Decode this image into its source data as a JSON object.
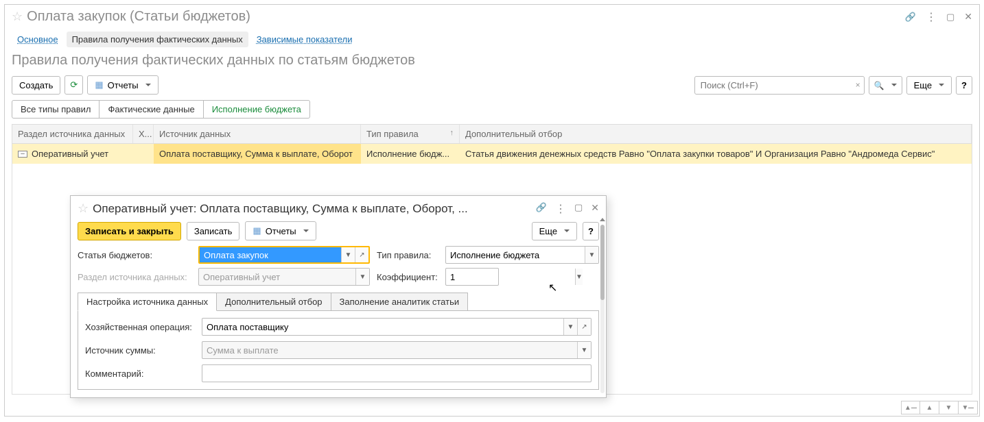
{
  "header": {
    "title": "Оплата закупок (Статьи бюджетов)"
  },
  "nav": {
    "main": "Основное",
    "rules": "Правила получения фактических данных",
    "dependent": "Зависимые показатели"
  },
  "page_subtitle": "Правила получения фактических данных по статьям бюджетов",
  "toolbar": {
    "create": "Создать",
    "reports": "Отчеты",
    "more": "Еще",
    "search_placeholder": "Поиск (Ctrl+F)"
  },
  "filter_tabs": {
    "all": "Все типы правил",
    "actual": "Фактические данные",
    "execution": "Исполнение бюджета"
  },
  "grid": {
    "columns": {
      "section": "Раздел источника данных",
      "h": "Х...",
      "source": "Источник данных",
      "rule_type": "Тип правила",
      "filter": "Дополнительный отбор"
    },
    "rows": [
      {
        "section": "Оперативный учет",
        "h": "",
        "source": "Оплата поставщику, Сумма к выплате, Оборот",
        "rule_type": "Исполнение бюдж...",
        "filter": "Статья движения денежных средств Равно \"Оплата закупки товаров\" И Организация Равно \"Андромеда Сервис\""
      }
    ]
  },
  "dialog": {
    "title": "Оперативный учет: Оплата поставщику, Сумма к выплате, Оборот, ...",
    "save_close": "Записать и закрыть",
    "save": "Записать",
    "reports": "Отчеты",
    "more": "Еще",
    "labels": {
      "budget_item": "Статья бюджетов:",
      "rule_type": "Тип правила:",
      "section": "Раздел источника данных:",
      "coefficient": "Коэффициент:",
      "operation": "Хозяйственная операция:",
      "sum_source": "Источник суммы:",
      "comment": "Комментарий:"
    },
    "values": {
      "budget_item": "Оплата закупок",
      "rule_type": "Исполнение бюджета",
      "section": "Оперативный учет",
      "coefficient": "1",
      "operation": "Оплата поставщику",
      "sum_source": "Сумма к выплате",
      "comment": ""
    },
    "subtabs": {
      "source": "Настройка источника данных",
      "filter": "Дополнительный отбор",
      "analytics": "Заполнение аналитик статьи"
    }
  }
}
